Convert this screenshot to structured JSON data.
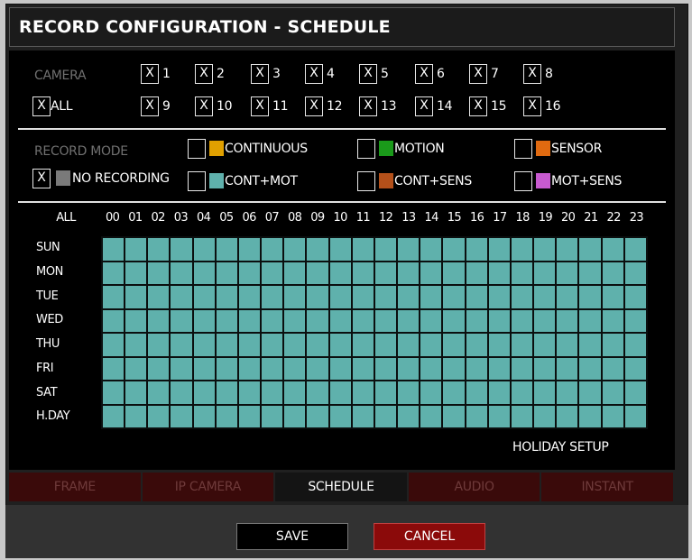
{
  "title": "RECORD CONFIGURATION - SCHEDULE",
  "camera": {
    "label": "CAMERA",
    "all_label": "ALL",
    "all_checked": "X",
    "row1": [
      {
        "num": "1",
        "mark": "X"
      },
      {
        "num": "2",
        "mark": "X"
      },
      {
        "num": "3",
        "mark": "X"
      },
      {
        "num": "4",
        "mark": "X"
      },
      {
        "num": "5",
        "mark": "X"
      },
      {
        "num": "6",
        "mark": "X"
      },
      {
        "num": "7",
        "mark": "X"
      },
      {
        "num": "8",
        "mark": "X"
      }
    ],
    "row2": [
      {
        "num": "9",
        "mark": "X"
      },
      {
        "num": "10",
        "mark": "X"
      },
      {
        "num": "11",
        "mark": "X"
      },
      {
        "num": "12",
        "mark": "X"
      },
      {
        "num": "13",
        "mark": "X"
      },
      {
        "num": "14",
        "mark": "X"
      },
      {
        "num": "15",
        "mark": "X"
      },
      {
        "num": "16",
        "mark": "X"
      }
    ]
  },
  "record_mode": {
    "label": "RECORD MODE",
    "no_recording": {
      "label": "NO RECORDING",
      "mark": "X",
      "color": "#7a7a7a"
    },
    "modes": [
      {
        "label": "CONTINUOUS",
        "mark": "",
        "color": "#e0a000"
      },
      {
        "label": "MOTION",
        "mark": "",
        "color": "#1a9a1a"
      },
      {
        "label": "SENSOR",
        "mark": "",
        "color": "#e06a10"
      },
      {
        "label": "CONT+MOT",
        "mark": "",
        "color": "#5fb1ac"
      },
      {
        "label": "CONT+SENS",
        "mark": "",
        "color": "#b4501a"
      },
      {
        "label": "MOT+SENS",
        "mark": "",
        "color": "#c85ad0"
      }
    ]
  },
  "schedule": {
    "all_label": "ALL",
    "hours": [
      "00",
      "01",
      "02",
      "03",
      "04",
      "05",
      "06",
      "07",
      "08",
      "09",
      "10",
      "11",
      "12",
      "13",
      "14",
      "15",
      "16",
      "17",
      "18",
      "19",
      "20",
      "21",
      "22",
      "23"
    ],
    "days": [
      "SUN",
      "MON",
      "TUE",
      "WED",
      "THU",
      "FRI",
      "SAT",
      "H.DAY"
    ],
    "cell_color": "#5fb1ac"
  },
  "holiday_setup": "HOLIDAY SETUP",
  "tabs": [
    "FRAME",
    "IP CAMERA",
    "SCHEDULE",
    "AUDIO",
    "INSTANT"
  ],
  "active_tab": "SCHEDULE",
  "buttons": {
    "save": "SAVE",
    "cancel": "CANCEL"
  }
}
